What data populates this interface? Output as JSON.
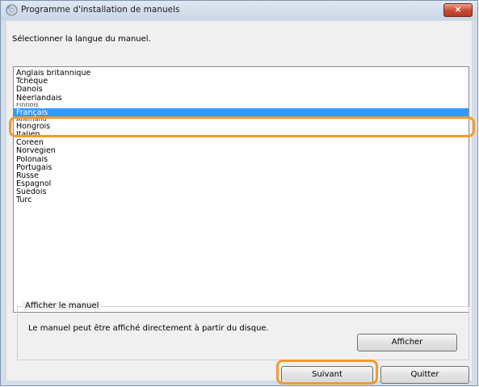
{
  "window": {
    "title": "Programme d'installation de manuels",
    "close_label": "×"
  },
  "prompt": "Sélectionner la langue du manuel.",
  "languages": [
    "Anglais britannique",
    "Tchèque",
    "Danois",
    "Néerlandais",
    "Finnois",
    "Français",
    "Allemand",
    "Hongrois",
    "Italien",
    "Coréen",
    "Norvégien",
    "Polonais",
    "Portugais",
    "Russe",
    "Espagnol",
    "Suédois",
    "Turc"
  ],
  "selected_language": "Français",
  "manual_group": {
    "label": "Afficher le manuel",
    "description": "Le manuel peut être affiché directement à partir du disque.",
    "view_button": "Afficher"
  },
  "buttons": {
    "next": "Suivant",
    "quit": "Quitter"
  },
  "colors": {
    "highlight": "#f29a2e",
    "selection": "#3399ff"
  }
}
